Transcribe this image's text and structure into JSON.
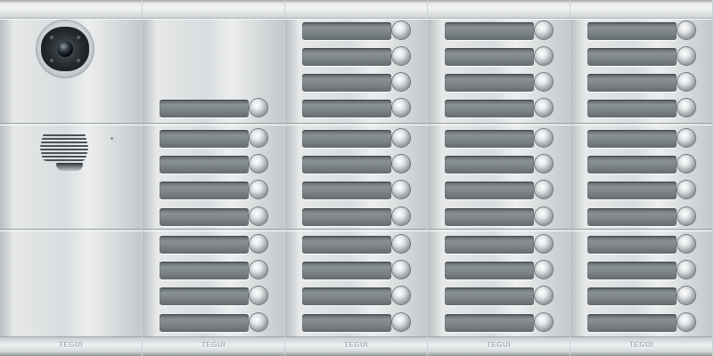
{
  "brand": "TEGUI",
  "panel": {
    "columns": [
      {
        "id": "camera-column",
        "module1": "camera",
        "module2": "speaker",
        "module3": "blank",
        "buttons_module1": 0,
        "buttons_module2": 0,
        "buttons_module3": 0
      },
      {
        "id": "column-2",
        "buttons_module1": 1,
        "buttons_module2": 4,
        "buttons_module3": 4
      },
      {
        "id": "column-3",
        "buttons_module1": 4,
        "buttons_module2": 4,
        "buttons_module3": 4
      },
      {
        "id": "column-4",
        "buttons_module1": 4,
        "buttons_module2": 4,
        "buttons_module3": 4
      },
      {
        "id": "column-5",
        "buttons_module1": 4,
        "buttons_module2": 4,
        "buttons_module3": 4
      }
    ]
  },
  "colors": {
    "finish": "#d9dcde",
    "label_plate": "#7c8387",
    "camera_window": "#26292b"
  },
  "icons": {
    "camera": "camera-lens-icon",
    "speaker": "speaker-grille-icon",
    "button": "push-button-icon"
  }
}
